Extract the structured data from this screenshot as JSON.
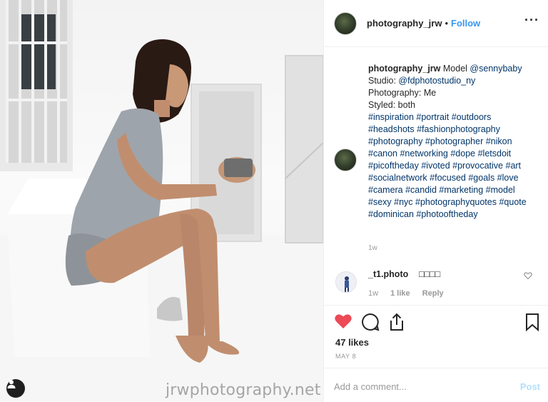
{
  "photo": {
    "watermark": "jrwphotography.net",
    "user_tag_icon": "person-icon"
  },
  "header": {
    "username": "photography_jrw",
    "separator": "•",
    "follow_label": "Follow",
    "more_icon": "more-horizontal-icon"
  },
  "caption": {
    "username": "photography_jrw",
    "text_intro": "Model",
    "mention_model": "@sennybaby",
    "studio_label": "Studio:",
    "mention_studio": "@fdphotostudio_ny",
    "photography_line": "Photography: Me",
    "styled_line": "Styled: both",
    "hashtags": "#inspiration #portrait #outdoors #headshots #fashionphotography #photography #photographer #nikon #canon #networking #dope #letsdoit #picoftheday #ivoted #provocative #art #socialnetwork #focused #goals #love #camera #candid #marketing #model #sexy #nyc #photographyquotes #quote #dominican #photooftheday",
    "time": "1w"
  },
  "comment": {
    "username": "_t1.photo",
    "text": "□□□□",
    "time": "1w",
    "likes": "1 like",
    "reply_label": "Reply"
  },
  "actions": {
    "icons": [
      "heart-filled-icon",
      "comment-icon",
      "share-icon",
      "bookmark-icon"
    ],
    "likes_text": "47 likes",
    "date": "MAY 8",
    "heart_color": "#ed4956"
  },
  "add_comment": {
    "placeholder": "Add a comment...",
    "post_label": "Post"
  }
}
